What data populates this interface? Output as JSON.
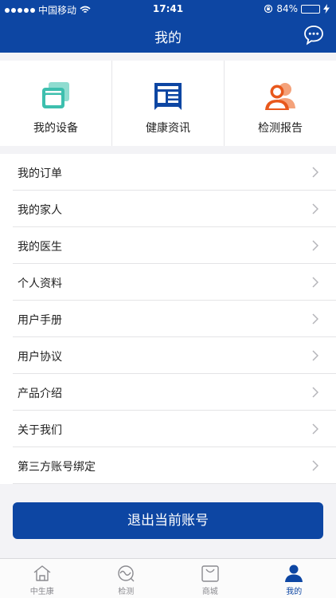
{
  "status_bar": {
    "carrier": "中国移动",
    "time": "17:41",
    "battery": "84%",
    "battery_level": 0.84
  },
  "nav": {
    "title": "我的"
  },
  "quick_actions": [
    {
      "label": "我的设备",
      "icon": "device-icon",
      "color": "#3dbfae"
    },
    {
      "label": "健康资讯",
      "icon": "news-icon",
      "color": "#0d46a3"
    },
    {
      "label": "检测报告",
      "icon": "users-icon",
      "color": "#e8581c"
    }
  ],
  "menu": [
    {
      "label": "我的订单"
    },
    {
      "label": "我的家人"
    },
    {
      "label": "我的医生"
    },
    {
      "label": "个人资料"
    },
    {
      "label": "用户手册"
    },
    {
      "label": "用户协议"
    },
    {
      "label": "产品介绍"
    },
    {
      "label": "关于我们"
    },
    {
      "label": "第三方账号绑定"
    }
  ],
  "logout": {
    "label": "退出当前账号"
  },
  "tabs": [
    {
      "label": "中生康",
      "icon": "home-icon",
      "active": false
    },
    {
      "label": "检测",
      "icon": "monitor-icon",
      "active": false
    },
    {
      "label": "商城",
      "icon": "shop-bag-icon",
      "active": false
    },
    {
      "label": "我的",
      "icon": "profile-icon",
      "active": true
    }
  ],
  "colors": {
    "primary": "#0d46a3",
    "background": "#f3f3f6"
  }
}
